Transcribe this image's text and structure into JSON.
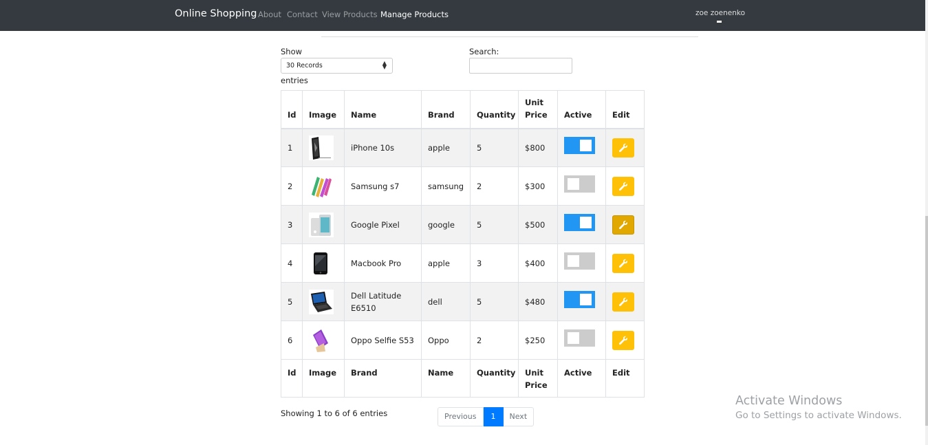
{
  "navbar": {
    "brand": "Online Shopping",
    "links": [
      {
        "label": "About",
        "active": false
      },
      {
        "label": "Contact",
        "active": false
      },
      {
        "label": "View Products",
        "active": false
      },
      {
        "label": "Manage Products",
        "active": true
      }
    ],
    "user": "zoe zoenenko"
  },
  "controls": {
    "show_label": "Show",
    "page_size": "30 Records",
    "entries_label": "entries",
    "search_label": "Search:",
    "search_value": ""
  },
  "table": {
    "header": [
      "Id",
      "Image",
      "Name",
      "Brand",
      "Quantity",
      "Unit Price",
      "Active",
      "Edit"
    ],
    "footer": [
      "Id",
      "Image",
      "Brand",
      "Name",
      "Quantity",
      "Unit Price",
      "Active",
      "Edit"
    ],
    "rows": [
      {
        "id": "1",
        "image": "phone-icon",
        "name": "iPhone 10s",
        "brand": "apple",
        "quantity": "5",
        "price": "$800",
        "active": true
      },
      {
        "id": "2",
        "image": "phone-icon",
        "name": "Samsung s7",
        "brand": "samsung",
        "quantity": "2",
        "price": "$300",
        "active": false
      },
      {
        "id": "3",
        "image": "phone-icon",
        "name": "Google Pixel",
        "brand": "google",
        "quantity": "5",
        "price": "$500",
        "active": true
      },
      {
        "id": "4",
        "image": "phone-icon",
        "name": "Macbook Pro",
        "brand": "apple",
        "quantity": "3",
        "price": "$400",
        "active": false
      },
      {
        "id": "5",
        "image": "laptop-icon",
        "name": "Dell Latitude E6510",
        "brand": "dell",
        "quantity": "5",
        "price": "$480",
        "active": true
      },
      {
        "id": "6",
        "image": "phone-icon",
        "name": "Oppo Selfie S53",
        "brand": "Oppo",
        "quantity": "2",
        "price": "$250",
        "active": false
      }
    ]
  },
  "pagination": {
    "info": "Showing 1 to 6 of 6 entries",
    "previous": "Previous",
    "current": "1",
    "next": "Next"
  },
  "watermark": {
    "title": "Activate Windows",
    "subtitle": "Go to Settings to activate Windows."
  },
  "colors": {
    "navbar": "#343a40",
    "toggle_on": "#2196f3",
    "toggle_off": "#cccccc",
    "edit_button": "#ffc107",
    "page_active": "#007bff"
  }
}
